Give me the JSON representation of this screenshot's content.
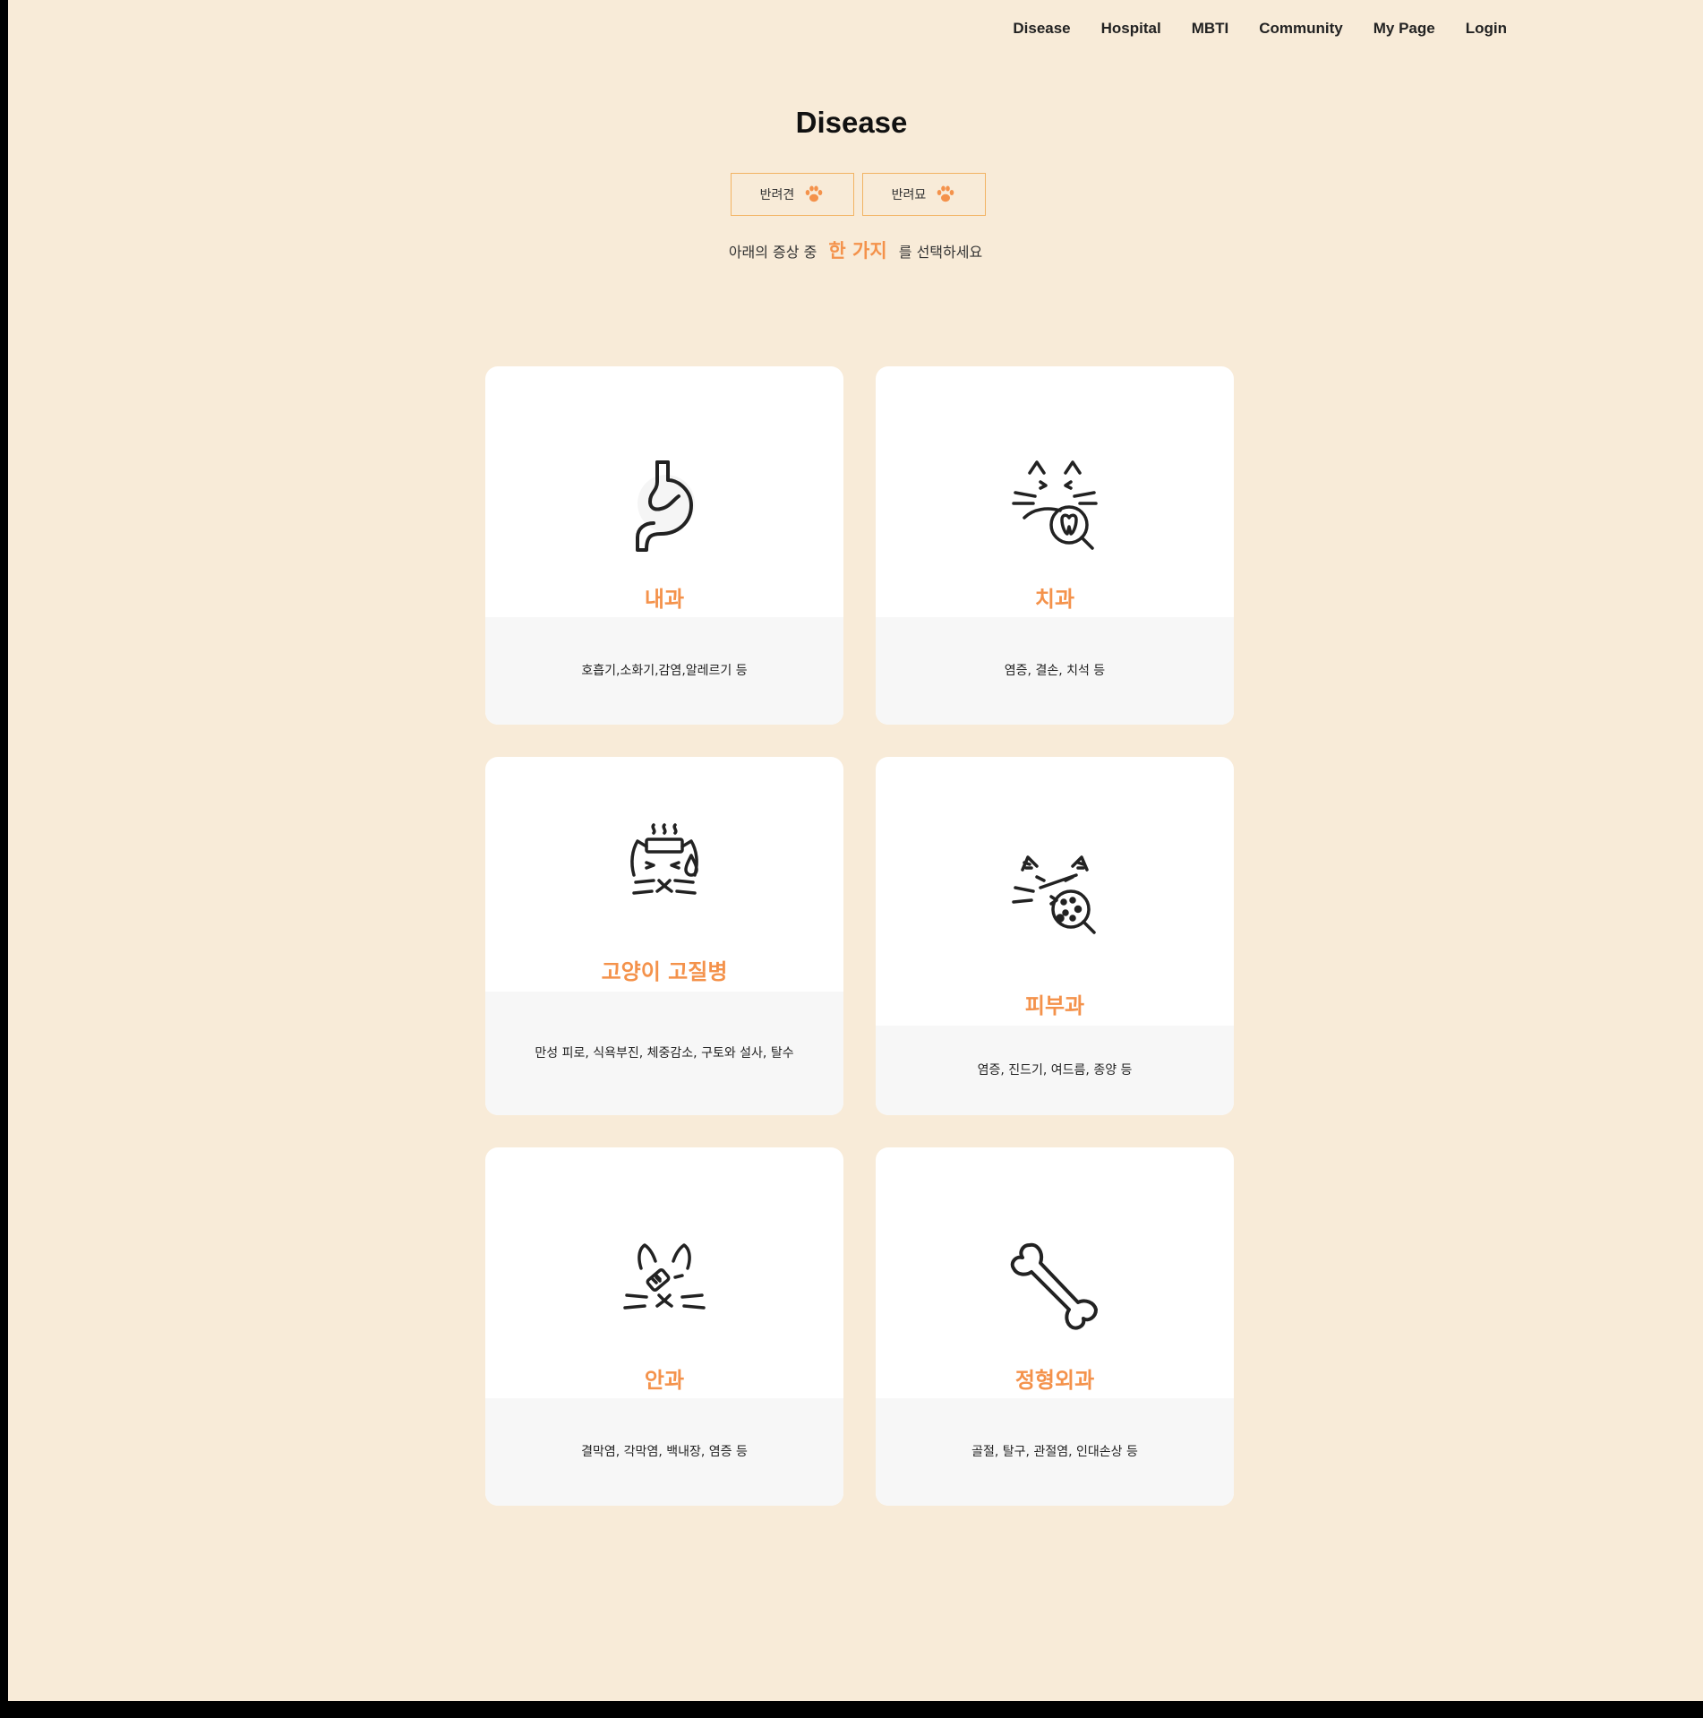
{
  "nav": {
    "items": [
      "Disease",
      "Hospital",
      "MBTI",
      "Community",
      "My Page",
      "Login"
    ]
  },
  "page_title": "Disease",
  "pet_toggle": {
    "dog": "반려견",
    "cat": "반려묘"
  },
  "instruction": {
    "before": "아래의 증상 중",
    "highlight": "한 가지",
    "after": "를 선택하세요"
  },
  "categories": [
    {
      "name": "내과",
      "desc": "호흡기,소화기,감염,알레르기 등",
      "icon": "stomach-icon"
    },
    {
      "name": "치과",
      "desc": "염증, 결손, 치석 등",
      "icon": "cat-tooth-magnifier-icon"
    },
    {
      "name": "고양이 고질병",
      "desc": "만성 피로, 식욕부진, 체중감소, 구토와 설사, 탈수",
      "icon": "cat-fever-icon"
    },
    {
      "name": "피부과",
      "desc": "염증, 진드기, 여드름, 종양 등",
      "icon": "cat-skin-magnifier-icon"
    },
    {
      "name": "안과",
      "desc": "결막염, 각막염, 백내장, 염증 등",
      "icon": "cat-eye-bandage-icon"
    },
    {
      "name": "정형외과",
      "desc": "골절, 탈구, 관절염, 인대손상 등",
      "icon": "bone-icon"
    }
  ],
  "colors": {
    "background": "#f8ebd8",
    "accent": "#f4924b",
    "button_border": "#f2b363",
    "card": "#ffffff",
    "card_bottom": "#f7f7f7"
  }
}
